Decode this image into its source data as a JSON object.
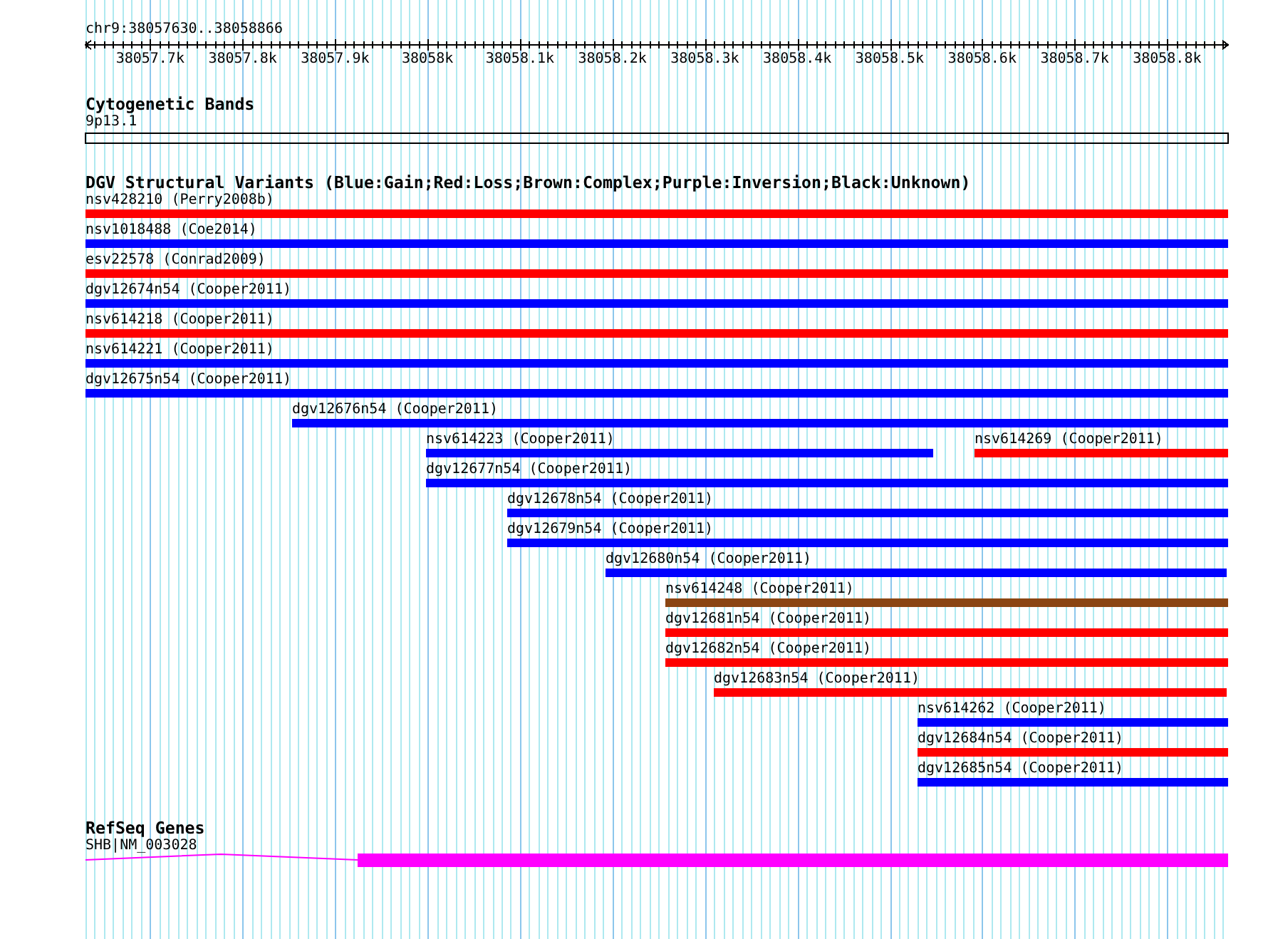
{
  "ruler": {
    "region": "chr9:38057630..38058866",
    "ticks": [
      "38057.7k",
      "38057.8k",
      "38057.9k",
      "38058k",
      "38058.1k",
      "38058.2k",
      "38058.3k",
      "38058.4k",
      "38058.5k",
      "38058.6k",
      "38058.7k",
      "38058.8k"
    ]
  },
  "cytogenetic_bands": {
    "title": "Cytogenetic Bands",
    "band": "9p13.1"
  },
  "dgv_variants": {
    "title": "DGV Structural Variants (Blue:Gain;Red:Loss;Brown:Complex;Purple:Inversion;Black:Unknown)",
    "rows": [
      {
        "features": [
          {
            "label": "nsv428210 (Perry2008b)",
            "color": "#ff0000"
          }
        ]
      },
      {
        "features": [
          {
            "label": "nsv1018488 (Coe2014)",
            "color": "#0000ff"
          }
        ]
      },
      {
        "features": [
          {
            "label": "esv22578 (Conrad2009)",
            "color": "#ff0000"
          }
        ]
      },
      {
        "features": [
          {
            "label": "dgv12674n54 (Cooper2011)",
            "color": "#0000ff"
          }
        ]
      },
      {
        "features": [
          {
            "label": "nsv614218 (Cooper2011)",
            "color": "#ff0000"
          }
        ]
      },
      {
        "features": [
          {
            "label": "nsv614221 (Cooper2011)",
            "color": "#0000ff"
          }
        ]
      },
      {
        "features": [
          {
            "label": "dgv12675n54 (Cooper2011)",
            "color": "#0000ff"
          }
        ]
      },
      {
        "features": [
          {
            "label": "dgv12676n54 (Cooper2011)",
            "color": "#0000ff"
          }
        ]
      },
      {
        "features": [
          {
            "label": "nsv614223 (Cooper2011)",
            "color": "#0000ff"
          },
          {
            "label": "nsv614269 (Cooper2011)",
            "color": "#ff0000"
          }
        ]
      },
      {
        "features": [
          {
            "label": "dgv12677n54 (Cooper2011)",
            "color": "#0000ff"
          }
        ]
      },
      {
        "features": [
          {
            "label": "dgv12678n54 (Cooper2011)",
            "color": "#0000ff"
          }
        ]
      },
      {
        "features": [
          {
            "label": "dgv12679n54 (Cooper2011)",
            "color": "#0000ff"
          }
        ]
      },
      {
        "features": [
          {
            "label": "dgv12680n54 (Cooper2011)",
            "color": "#0000ff"
          }
        ]
      },
      {
        "features": [
          {
            "label": "nsv614248 (Cooper2011)",
            "color": "#8b4513"
          }
        ]
      },
      {
        "features": [
          {
            "label": "dgv12681n54 (Cooper2011)",
            "color": "#ff0000"
          }
        ]
      },
      {
        "features": [
          {
            "label": "dgv12682n54 (Cooper2011)",
            "color": "#ff0000"
          }
        ]
      },
      {
        "features": [
          {
            "label": "dgv12683n54 (Cooper2011)",
            "color": "#ff0000"
          }
        ]
      },
      {
        "features": [
          {
            "label": "nsv614262 (Cooper2011)",
            "color": "#0000ff"
          }
        ]
      },
      {
        "features": [
          {
            "label": "dgv12684n54 (Cooper2011)",
            "color": "#ff0000"
          }
        ]
      },
      {
        "features": [
          {
            "label": "dgv12685n54 (Cooper2011)",
            "color": "#0000ff"
          }
        ]
      }
    ]
  },
  "refseq_genes": {
    "title": "RefSeq Genes",
    "gene": "SHB|NM_003028"
  }
}
